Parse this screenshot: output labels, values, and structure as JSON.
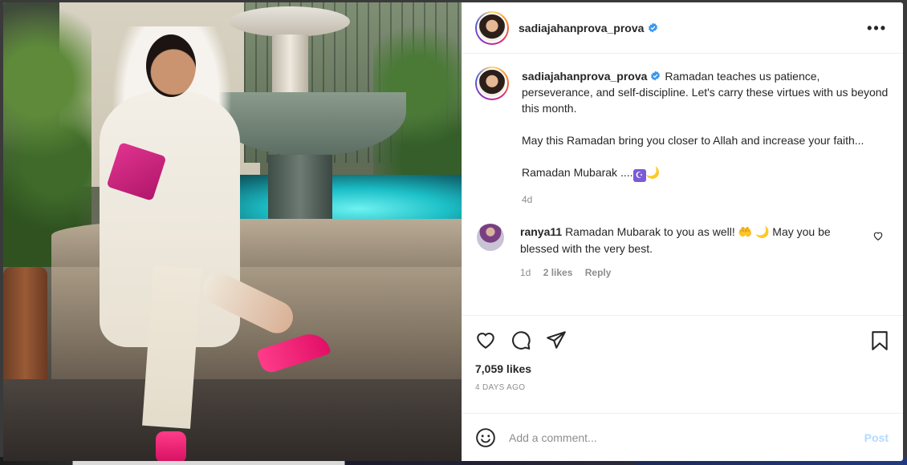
{
  "post": {
    "username": "sadiajahanprova_prova",
    "verified": true,
    "more_label": "•••",
    "caption": {
      "line1": "Ramadan teaches us patience, perseverance, and self-discipline. Let's carry these virtues with us beyond this month.",
      "line2": "May this Ramadan bring you closer to Allah and increase your faith...",
      "line3": "Ramadan Mubarak ....",
      "emoji_box": "☪",
      "emoji_moon": "🌙",
      "age": "4d"
    },
    "comment": {
      "username": "ranya11",
      "text_before": "Ramadan Mubarak to you as well! ",
      "emoji_hands": "🤲",
      "emoji_moon": "🌙",
      "text_after": " May you be blessed with the very best.",
      "age": "1d",
      "likes": "2 likes",
      "reply": "Reply"
    },
    "likes_count": "7,059 likes",
    "posted_ago": "4 DAYS AGO"
  },
  "composer": {
    "placeholder": "Add a comment...",
    "post_label": "Post"
  },
  "icons": {
    "like": "heart-icon",
    "comment": "comment-bubble-icon",
    "share": "paper-plane-icon",
    "save": "bookmark-icon",
    "emoji": "smiley-icon",
    "verified": "verified-badge-icon",
    "more": "more-options-icon"
  },
  "colors": {
    "verified_blue": "#3897f0",
    "post_button_disabled": "#b3dbff",
    "muted_text": "#8e8e8e"
  }
}
